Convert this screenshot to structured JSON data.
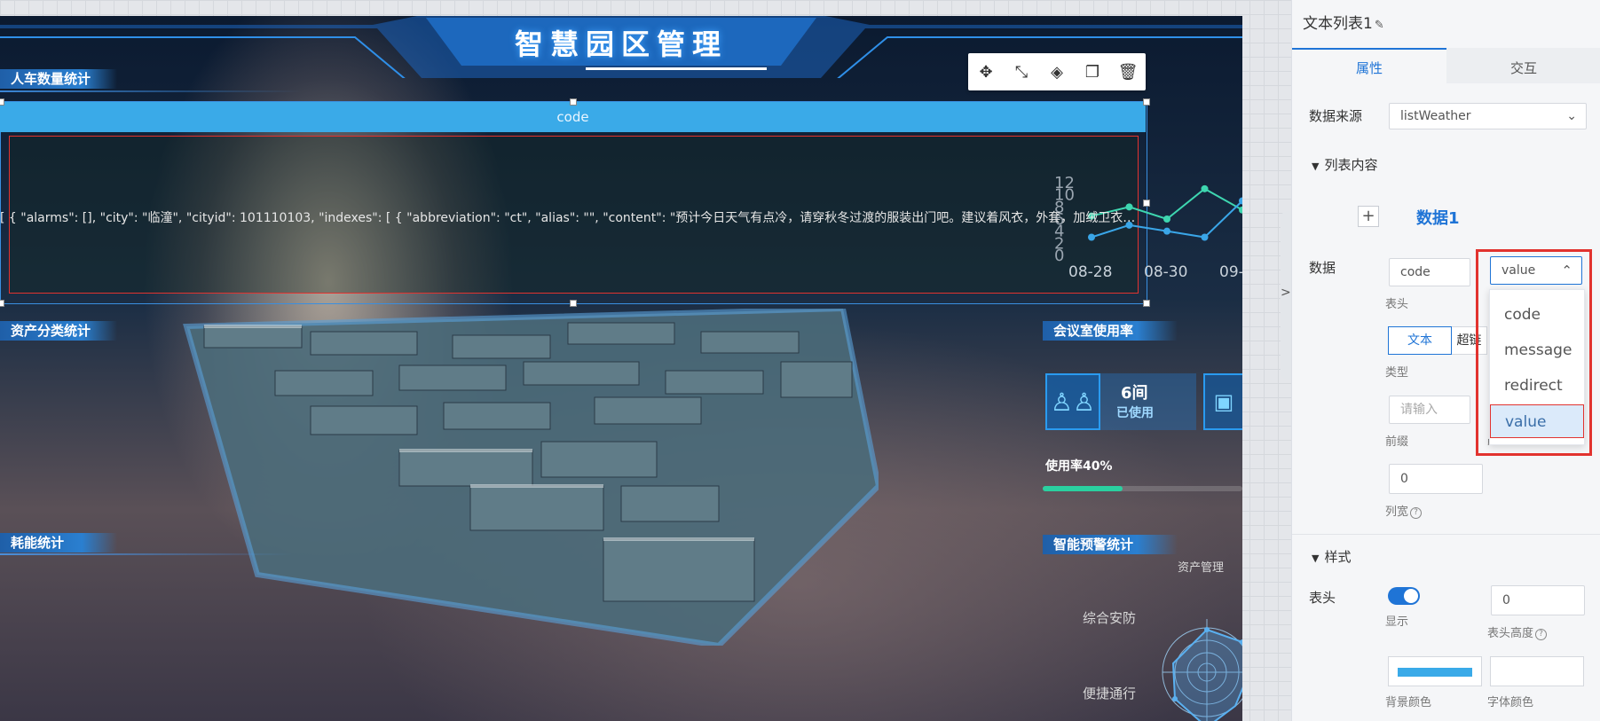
{
  "dashboard": {
    "title": "智慧园区管理",
    "sections": {
      "people_vehicle": "人车数量统计",
      "asset_category": "资产分类统计",
      "energy": "耗能统计",
      "meeting_usage": "会议室使用率",
      "smart_alert": "智能预警统计"
    },
    "meeting": {
      "count": "6间",
      "label": "已使用",
      "usage_text": "使用率40%",
      "usage_fraction": 0.4
    },
    "radar_labels": [
      "资产管理",
      "综合安防",
      "便捷通行"
    ]
  },
  "widget": {
    "header_text": "code",
    "row_text": "[ { \"alarms\": [], \"city\": \"临潼\", \"cityid\": 101110103, \"indexes\": [ { \"abbreviation\": \"ct\", \"alias\": \"\", \"content\": \"预计今日天气有点冷，请穿秋冬过渡的服装出门吧。建议着风衣，外套，加绒卫衣等，既..."
  },
  "toolbar": {
    "icons": [
      "move-icon",
      "fullscreen-icon",
      "layers-icon",
      "copy-icon",
      "delete-icon"
    ],
    "glyphs": [
      "✥",
      "⤡",
      "◈",
      "❐",
      "🗑"
    ]
  },
  "chart_data": {
    "type": "line",
    "categories": [
      "08-28",
      "",
      "08-30",
      "",
      "09-"
    ],
    "y_ticks": [
      "12",
      "10",
      "8",
      "6",
      "4",
      "2",
      "0"
    ],
    "ylim": [
      0,
      12
    ],
    "series": [
      {
        "values": [
          6.5,
          8,
          6,
          11,
          7.5
        ],
        "color": "#3ed6b0"
      },
      {
        "values": [
          3,
          5,
          4,
          3,
          9
        ],
        "color": "#3aa6e8"
      }
    ]
  },
  "sidebar": {
    "title": "文本列表1",
    "edit_glyph": "✎",
    "tabs": [
      "属性",
      "交互"
    ],
    "data_source_label": "数据来源",
    "data_source_value": "listWeather",
    "list_content": "列表内容",
    "data_title": "数据1",
    "plus": "+",
    "data_label": "数据",
    "header_input": "code",
    "header_caption": "表头",
    "value_select": "value",
    "type_text_btn": "文本",
    "type_link_btn": "超链",
    "type_caption": "类型",
    "prefix_placeholder": "请输入",
    "prefix_caption": "前缀",
    "suffix_caption": "后缀",
    "col_width_value": "0",
    "col_width_caption": "列宽",
    "style_section": "样式",
    "header_label": "表头",
    "show_caption": "显示",
    "header_height_value": "0",
    "header_height_caption": "表头高度",
    "bg_color_caption": "背景颜色",
    "font_color_caption": "字体颜色",
    "bg_color": "#3aaae8",
    "dropdown_options": [
      "code",
      "message",
      "redirect",
      "value"
    ],
    "dropdown_selected": "value",
    "collapse_glyph": ">"
  }
}
